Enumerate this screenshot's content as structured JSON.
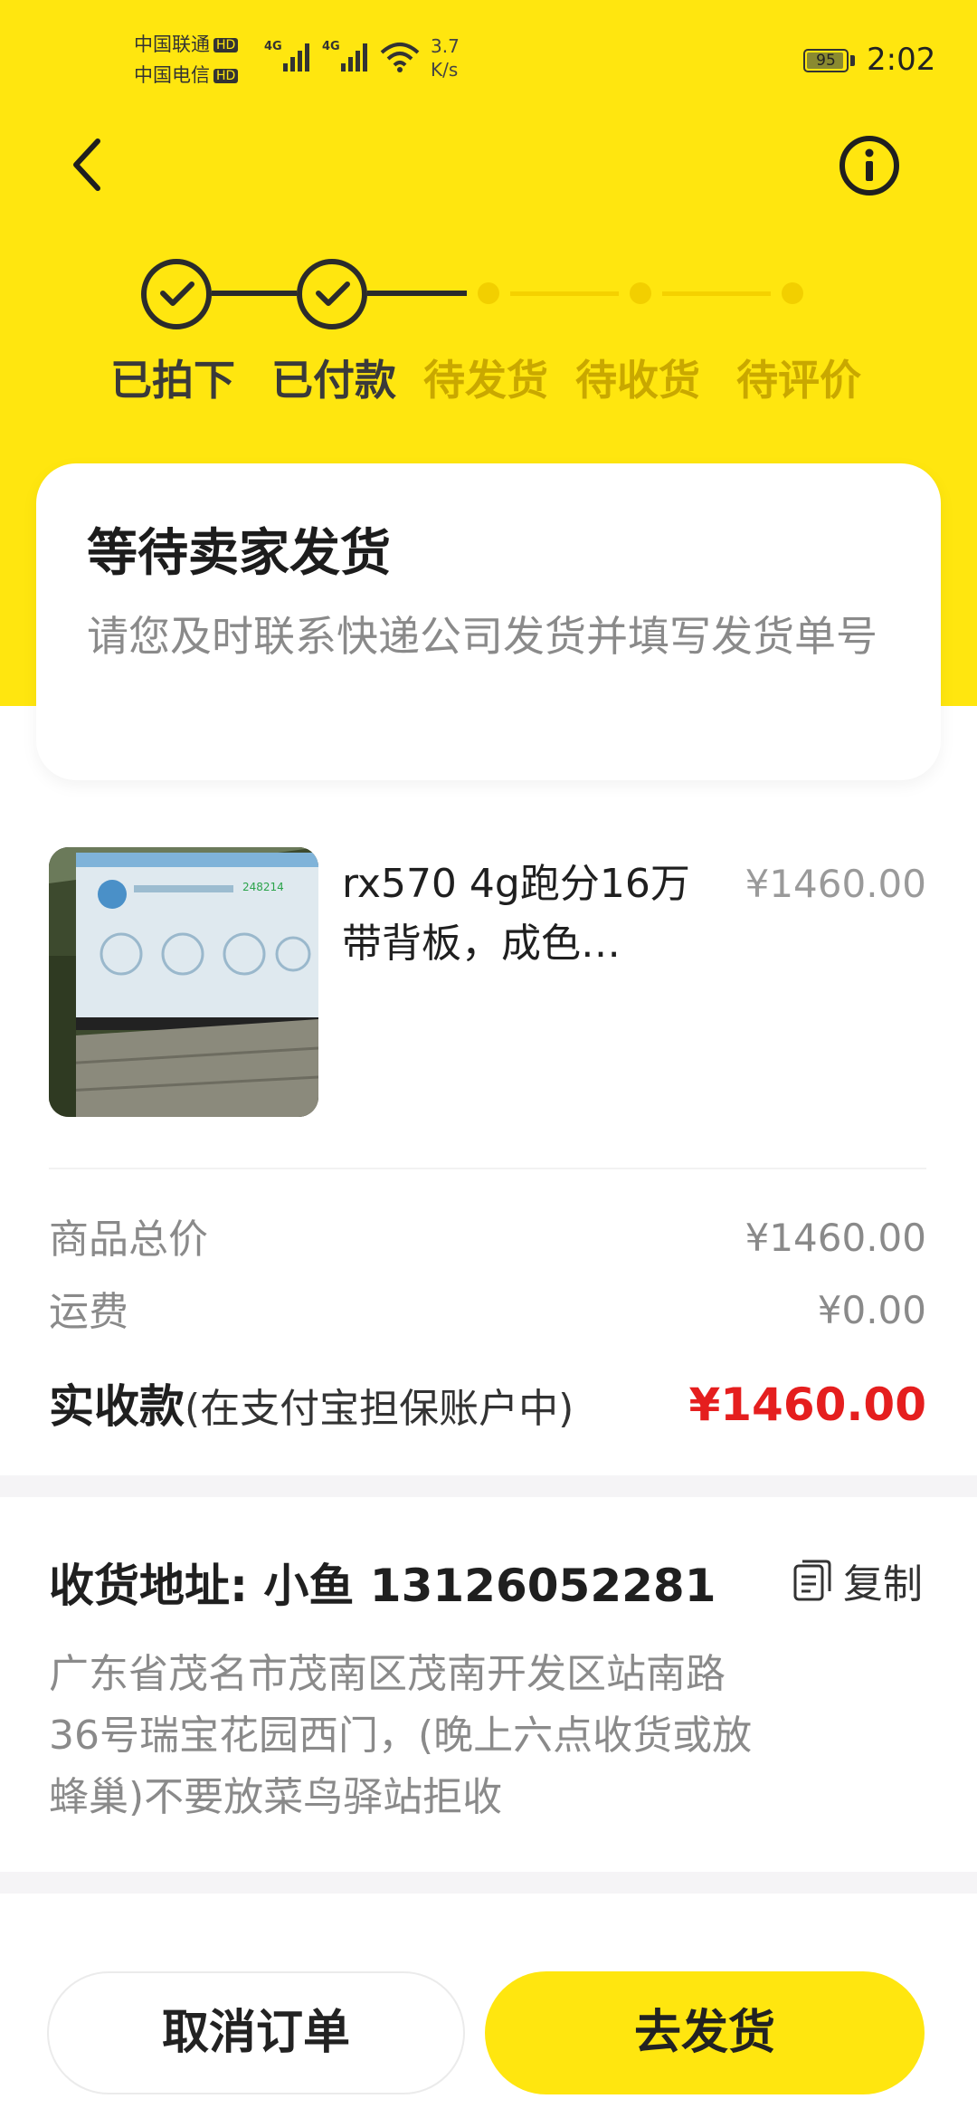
{
  "colors": {
    "brand_yellow": "#ffe60f",
    "step_done": "#2b2b2b",
    "step_todo": "#c9a800",
    "total_red": "#e51e1e",
    "muted_text": "#8a8a8a"
  },
  "status_bar": {
    "carrier_1": "中国联通",
    "carrier_2": "中国电信",
    "hd_badge": "HD",
    "network_1": "4G",
    "network_2": "4G",
    "speed_value": "3.7",
    "speed_unit": "K/s",
    "battery": "95",
    "battery_level": 0.95,
    "time": "2:02"
  },
  "nav": {
    "back_icon": "chevron-left-icon",
    "info_icon": "info-circle-icon"
  },
  "stepper": {
    "steps": [
      {
        "label": "已拍下",
        "done": true
      },
      {
        "label": "已付款",
        "done": true
      },
      {
        "label": "待发货",
        "done": false
      },
      {
        "label": "待收货",
        "done": false
      },
      {
        "label": "待评价",
        "done": false
      }
    ]
  },
  "status_card": {
    "title": "等待卖家发货",
    "description": "请您及时联系快递公司发货并填写发货单号"
  },
  "product": {
    "title": "rx570  4g跑分16万带背板，成色…",
    "price": "¥1460.00",
    "thumbnail_text": "248214"
  },
  "price_summary": {
    "subtotal_label": "商品总价",
    "subtotal_value": "¥1460.00",
    "shipping_label": "运费",
    "shipping_value": "¥0.00",
    "total_label": "实收款",
    "total_note": "(在支付宝担保账户中)",
    "total_value": "¥1460.00"
  },
  "address": {
    "title": "收货地址:  小鱼  13126052281",
    "copy_label": "复制",
    "body": "广东省茂名市茂南区茂南开发区站南路36号瑞宝花园西门，(晚上六点收货或放蜂巢)不要放菜鸟驿站拒收"
  },
  "actions": {
    "cancel": "取消订单",
    "ship": "去发货"
  }
}
